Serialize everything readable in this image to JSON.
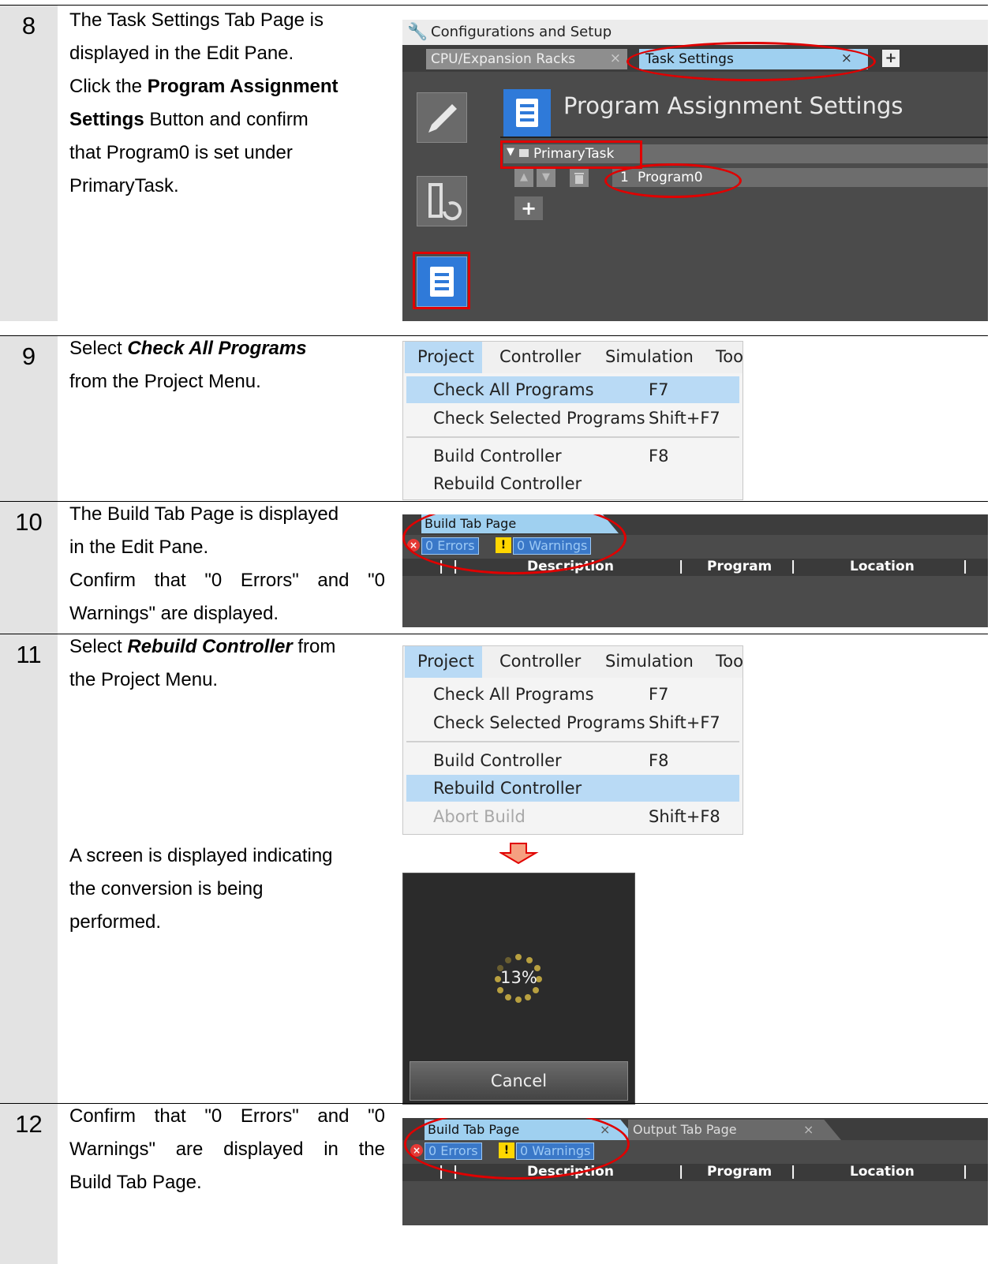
{
  "steps": [
    {
      "number": "8",
      "lines": [
        "The Task Settings Tab Page is",
        "displayed in the Edit Pane.",
        "Click the |Program Assignment|",
        "|Settings| Button and confirm",
        "that Program0 is set under",
        "PrimaryTask."
      ]
    },
    {
      "number": "9"
    },
    {
      "number": "10"
    },
    {
      "number": "11"
    },
    {
      "number": "12"
    }
  ],
  "step8": {
    "l1": "The Task Settings Tab Page is",
    "l2": "displayed in the Edit Pane.",
    "l3a": "Click the ",
    "l3b": "Program Assignment",
    "l4a": "Settings",
    "l4b": " Button and confirm",
    "l5": "that Program0 is set under",
    "l6": "PrimaryTask."
  },
  "step9": {
    "l1a": "Select ",
    "l1b": "Check All Programs",
    "l2": "from the Project Menu."
  },
  "step10": {
    "l1": "The Build Tab Page is displayed",
    "l2": "in the Edit Pane.",
    "l3": [
      "Confirm",
      "that",
      "\"0",
      "Errors\"",
      "and",
      "\"0"
    ],
    "l4": "Warnings\" are displayed."
  },
  "step11": {
    "l1a": "Select ",
    "l1b": "Rebuild Controller",
    "l1c": " from",
    "l2": "the Project Menu.",
    "l3": "A screen is displayed indicating",
    "l4": "the conversion is being",
    "l5": "performed."
  },
  "step12": {
    "l1": [
      "Confirm",
      "that",
      "\"0",
      "Errors\"",
      "and",
      "\"0"
    ],
    "l2": [
      "Warnings\"",
      "are",
      "displayed",
      "in",
      "the"
    ],
    "l3": "Build Tab Page."
  },
  "config_window": {
    "title": "Configurations and Setup",
    "tab1": "CPU/Expansion Racks",
    "tab1_close": "×",
    "tab2": "Task Settings",
    "tab2_close": "×",
    "add_tab": "+",
    "heading": "Program Assignment Settings",
    "task": "PrimaryTask",
    "program_index": "1",
    "program": "Program0",
    "add_program": "+"
  },
  "menu": {
    "bar": [
      "Project",
      "Controller",
      "Simulation",
      "Too"
    ],
    "check_all": "Check All Programs",
    "check_all_key": "F7",
    "check_selected": "Check Selected Programs",
    "check_selected_key": "Shift+F7",
    "build": "Build Controller",
    "build_key": "F8",
    "rebuild": "Rebuild Controller",
    "abort": "Abort Build",
    "abort_key": "Shift+F8"
  },
  "build_tab": {
    "tab": "Build Tab Page",
    "tab_close": "×",
    "output_tab": "Output Tab Page",
    "output_close": "×",
    "errors": "0 Errors",
    "warnings": "0 Warnings",
    "col_description": "Description",
    "col_program": "Program",
    "col_location": "Location"
  },
  "progress": {
    "percent_label": "13%",
    "percent_value": 13,
    "cancel": "Cancel"
  },
  "colors": {
    "highlight_red": "#e00000",
    "menu_highlight": "#b9daf5",
    "dark_pane": "#4b4b4b",
    "step_column": "#e3e3e3",
    "arrow_fill": "#f5a080"
  }
}
